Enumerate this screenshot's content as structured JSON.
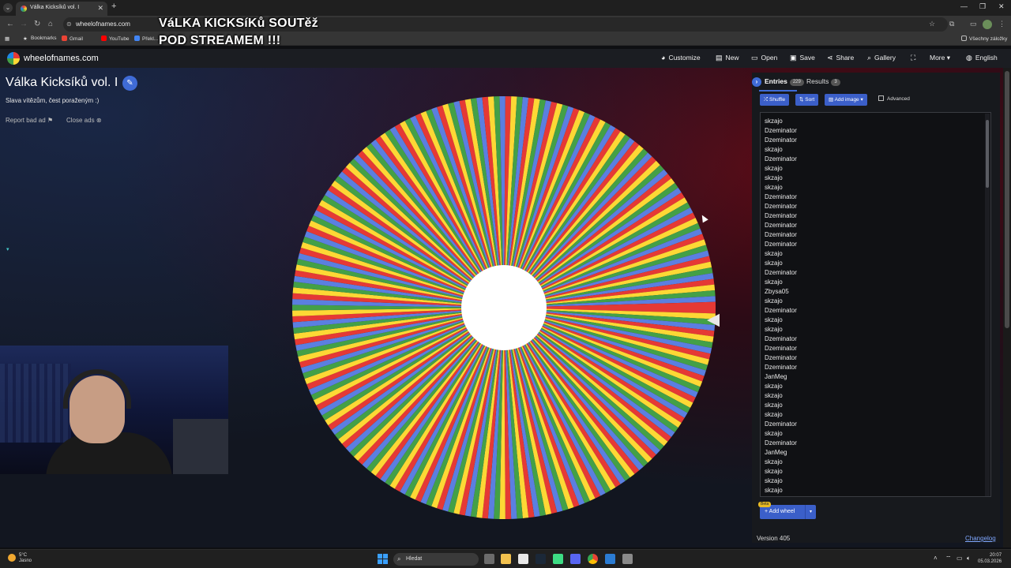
{
  "browser": {
    "tab_title": "Válka Kicksíků vol. I",
    "url": "wheelofnames.com",
    "bookmarks": [
      {
        "label": "Bookmarks",
        "icon": "star-icon"
      },
      {
        "label": "Gmail",
        "icon": "gmail-icon"
      },
      {
        "label": "YouTube",
        "icon": "youtube-icon"
      },
      {
        "label": "Překl...",
        "icon": "translate-icon"
      }
    ],
    "all_bookmarks_label": "Všechny záložky"
  },
  "overlay": {
    "line1": "VáLKA KICKSíKů SOUTěž",
    "line2": "POD STREAMEM !!!"
  },
  "site": {
    "name": "wheelofnames.com",
    "menu": [
      {
        "label": "Customize",
        "icon": "palette-icon"
      },
      {
        "label": "New",
        "icon": "file-icon"
      },
      {
        "label": "Open",
        "icon": "folder-icon"
      },
      {
        "label": "Save",
        "icon": "save-icon"
      },
      {
        "label": "Share",
        "icon": "share-icon"
      },
      {
        "label": "Gallery",
        "icon": "search-icon"
      },
      {
        "label": "",
        "icon": "fullscreen-icon"
      },
      {
        "label": "More",
        "icon": "chevron-down-icon"
      },
      {
        "label": "English",
        "icon": "globe-icon"
      }
    ]
  },
  "wheel": {
    "title": "Válka Kicksíků vol. I",
    "description": "Slava vítězům, čest poraženým :)",
    "report_ad": "Report bad ad",
    "close_ads": "Close ads",
    "segment_colors": [
      "#e53935",
      "#fdd835",
      "#43a047",
      "#5b7fe0"
    ],
    "segment_count": 229
  },
  "panel": {
    "entries_tab": "Entries",
    "entries_count": "229",
    "results_tab": "Results",
    "results_count": "3",
    "shuffle": "Shuffle",
    "sort": "Sort",
    "add_image": "Add image",
    "advanced": "Advanced",
    "entries": [
      "skzajo",
      "Dzeminator",
      "Dzeminator",
      "skzajo",
      "Dzeminator",
      "skzajo",
      "skzajo",
      "skzajo",
      "Dzeminator",
      "Dzeminator",
      "Dzeminator",
      "Dzeminator",
      "Dzeminator",
      "Dzeminator",
      "skzajo",
      "skzajo",
      "Dzeminator",
      "skzajo",
      "Zbysa05",
      "skzajo",
      "Dzeminator",
      "skzajo",
      "skzajo",
      "Dzeminator",
      "Dzeminator",
      "Dzeminator",
      "Dzeminator",
      "JanMeg",
      "skzajo",
      "skzajo",
      "skzajo",
      "skzajo",
      "Dzeminator",
      "skzajo",
      "Dzeminator",
      "JanMeg",
      "skzajo",
      "skzajo",
      "skzajo",
      "skzajo"
    ],
    "beta": "Beta",
    "add_wheel": "Add wheel",
    "version": "Version 405",
    "changelog": "Changelog"
  },
  "taskbar": {
    "weather_temp": "5°C",
    "weather_desc": "Jasno",
    "search_placeholder": "Hledat",
    "time": "20:07",
    "date": "05.03.2026"
  }
}
